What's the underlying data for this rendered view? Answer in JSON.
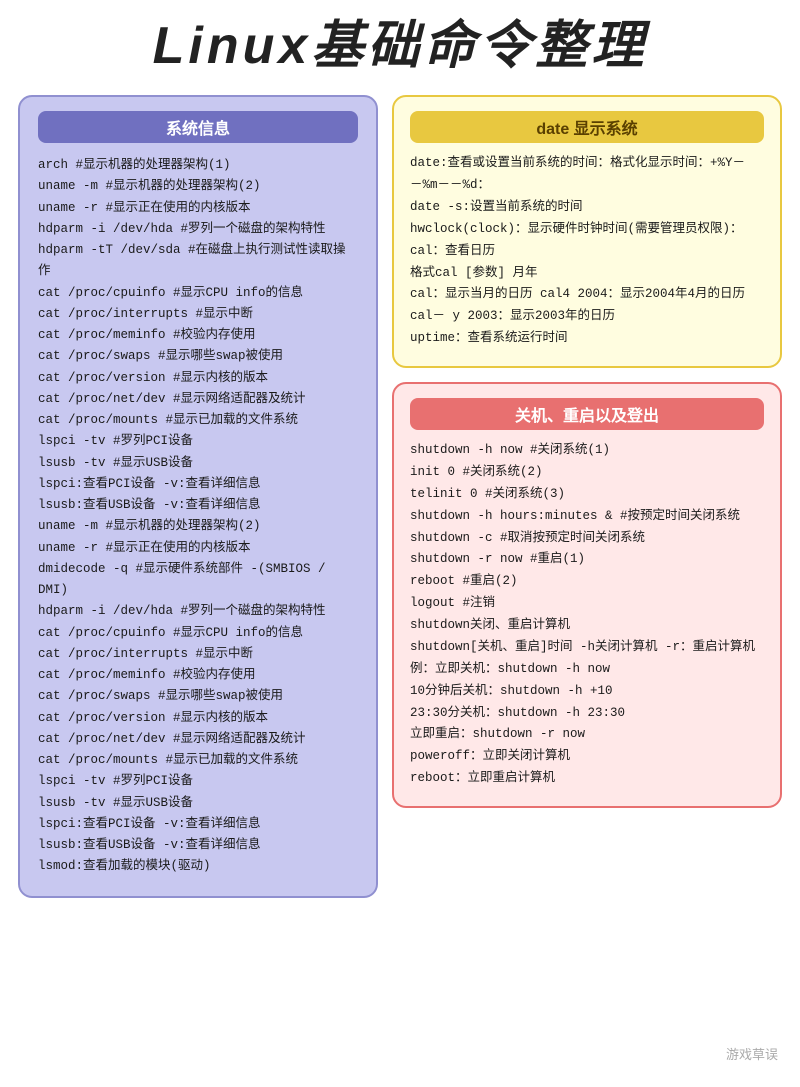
{
  "title": "Linux基础命令整理",
  "sys_panel": {
    "title": "系统信息",
    "content": [
      "arch      #显示机器的处理器架构(1)",
      "uname -m  #显示机器的处理器架构(2)",
      "uname -r  #显示正在使用的内核版本",
      "hdparm -i /dev/hda   #罗列一个磁盘的架构特性",
      "hdparm -tT /dev/sda  #在磁盘上执行测试性读取操作",
      "cat /proc/cpuinfo    #显示CPU info的信息",
      "cat /proc/interrupts #显示中断",
      "cat /proc/meminfo    #校验内存使用",
      "cat /proc/swaps      #显示哪些swap被使用",
      "cat /proc/version    #显示内核的版本",
      "cat /proc/net/dev    #显示网络适配器及统计",
      "cat /proc/mounts     #显示已加载的文件系统",
      "lspci -tv  #罗列PCI设备",
      "lsusb -tv  #显示USB设备",
      "lspci:查看PCI设备 -v:查看详细信息",
      "lsusb:查看USB设备 -v:查看详细信息",
      "uname -m  #显示机器的处理器架构(2)",
      "uname -r  #显示正在使用的内核版本",
      "dmidecode -q      #显示硬件系统部件 -(SMBIOS / DMI)",
      "hdparm -i /dev/hda   #罗列一个磁盘的架构特性",
      "cat /proc/cpuinfo    #显示CPU info的信息",
      "cat /proc/interrupts #显示中断",
      "cat /proc/meminfo    #校验内存使用",
      "cat /proc/swaps      #显示哪些swap被使用",
      "cat /proc/version    #显示内核的版本",
      "cat /proc/net/dev    #显示网络适配器及统计",
      "cat /proc/mounts     #显示已加载的文件系统",
      "lspci -tv  #罗列PCI设备",
      "lsusb -tv  #显示USB设备",
      "lspci:查看PCI设备 -v:查看详细信息",
      "lsusb:查看USB设备 -v:查看详细信息",
      "lsmod:查看加载的模块(驱动)"
    ]
  },
  "date_panel": {
    "title": "date 显示系统",
    "content": [
      "date:查看或设置当前系统的时间：格式化显示时间：+%Y－－%m－－%d：",
      "date -s:设置当前系统的时间",
      "hwclock(clock)：显示硬件时钟时间(需要管理员权限)：",
      "cal：查看日历",
      "格式cal [参数] 月年",
      "cal：显示当月的日历   cal4 2004：显示2004年4月的日历",
      "cal－ y 2003：显示2003年的日历",
      "uptime：查看系统运行时间"
    ]
  },
  "shutdown_panel": {
    "title": "关机、重启以及登出",
    "content": [
      "shutdown -h now   #关闭系统(1)",
      "init 0            #关闭系统(2)",
      "telinit 0         #关闭系统(3)",
      "shutdown -h hours:minutes & #按预定时间关闭系统",
      "shutdown -c   #取消按预定时间关闭系统",
      "shutdown -r now  #重启(1)",
      "reboot   #重启(2)",
      "logout   #注销",
      "shutdown关闭、重启计算机",
      "shutdown[关机、重启]时间 -h关闭计算机 -r：重启计算机",
      "例：立即关机：shutdown -h now",
      "10分钟后关机：shutdown -h +10",
      "23:30分关机：shutdown -h 23:30",
      "立即重启：shutdown -r now",
      "poweroff：立即关闭计算机",
      "reboot：立即重启计算机"
    ]
  },
  "watermark": "游戏草误"
}
